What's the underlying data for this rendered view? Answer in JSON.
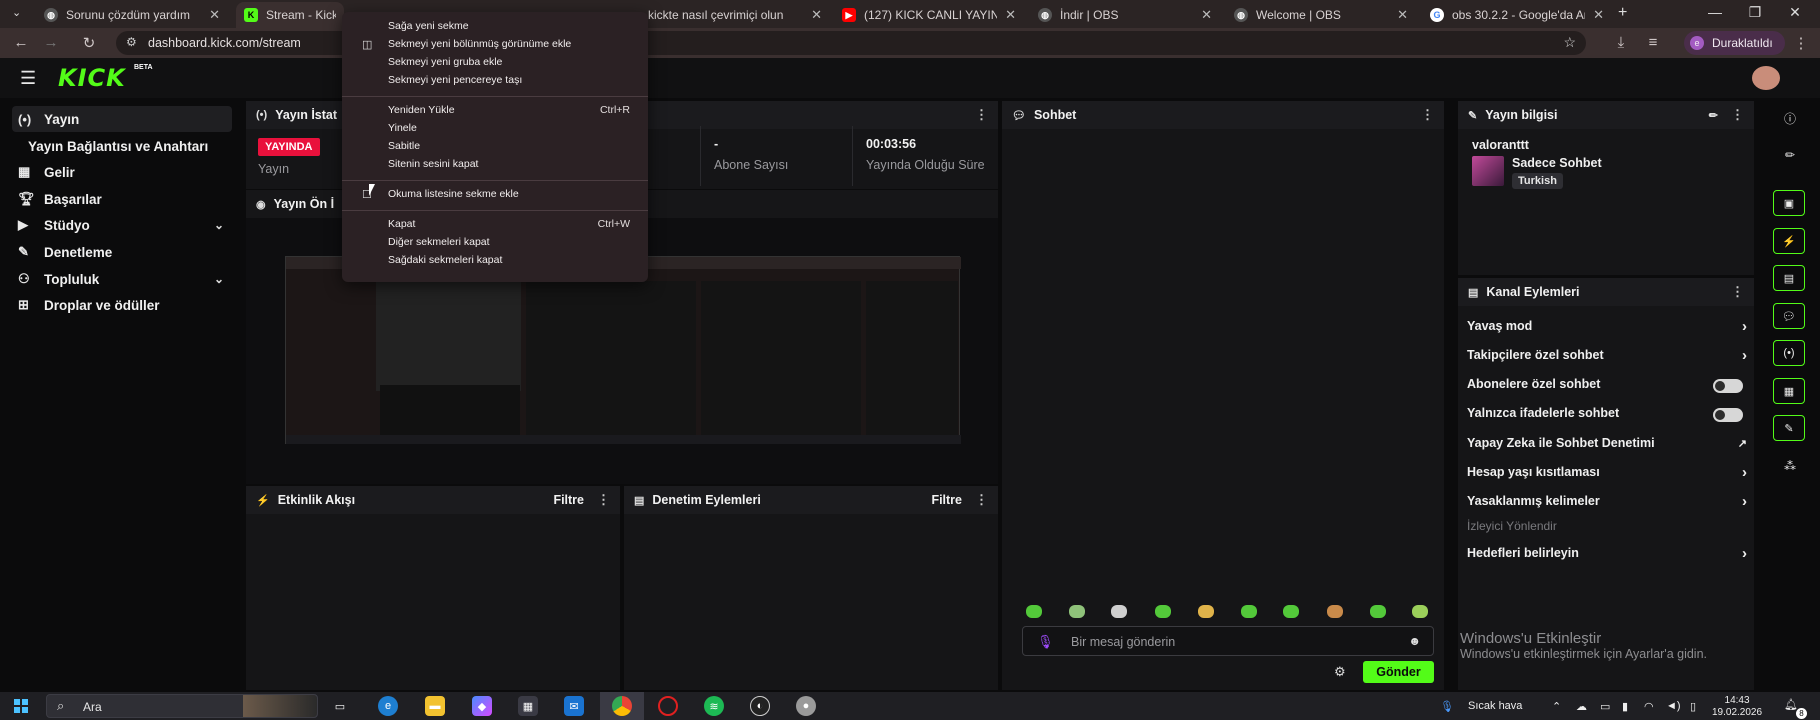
{
  "tabs": [
    {
      "title": "Sorunu çözdüm yardım",
      "icon": "globe-icon"
    },
    {
      "title": "Stream - Kick D",
      "icon": "kick-icon"
    },
    {
      "title": "kickte nasıl çevrimiçi olun",
      "icon": "globe-icon"
    },
    {
      "title": "(127) KICK CANLI YAYIN N",
      "icon": "youtube-icon"
    },
    {
      "title": "İndir | OBS",
      "icon": "globe-icon"
    },
    {
      "title": "Welcome | OBS",
      "icon": "globe-icon"
    },
    {
      "title": "obs 30.2.2 - Google'da Ar",
      "icon": "google-icon"
    }
  ],
  "address_bar": {
    "url": "dashboard.kick.com/stream",
    "profile_label": "Duraklatıldı",
    "profile_initial": "e"
  },
  "app": {
    "logo": "KICK",
    "beta": "BETA"
  },
  "sidebar": {
    "items": [
      {
        "label": "Yayın",
        "icon": "broadcast-icon",
        "active": true
      },
      {
        "label": "Yayın Bağlantısı ve Anahtarı",
        "icon": "",
        "active": false
      },
      {
        "label": "Gelir",
        "icon": "chart-icon",
        "active": false
      },
      {
        "label": "Başarılar",
        "icon": "trophy-icon",
        "active": false
      },
      {
        "label": "Stüdyo",
        "icon": "video-icon",
        "active": false,
        "expandable": true
      },
      {
        "label": "Denetleme",
        "icon": "wrench-icon",
        "active": false
      },
      {
        "label": "Topluluk",
        "icon": "community-icon",
        "active": false,
        "expandable": true
      },
      {
        "label": "Droplar ve ödüller",
        "icon": "gift-icon",
        "active": false
      }
    ]
  },
  "stats_panel": {
    "title": "Yayın İstat",
    "live_badge": "YAYINDA",
    "stats": [
      {
        "value": "",
        "label": "Yayın"
      },
      {
        "value": "-",
        "label": "Abone Sayısı"
      },
      {
        "value": "00:03:56",
        "label": "Yayında Olduğu Süre"
      }
    ]
  },
  "preview_panel": {
    "title": "Yayın Ön İ"
  },
  "activity_panel": {
    "title": "Etkinlik Akışı",
    "filter": "Filtre"
  },
  "moderation_panel": {
    "title": "Denetim Eylemleri",
    "filter": "Filtre"
  },
  "chat_panel": {
    "title": "Sohbet",
    "input_placeholder": "Bir mesaj gönderin",
    "send_label": "Gönder"
  },
  "stream_info": {
    "title": "Yayın bilgisi",
    "stream_title": "valoranttt",
    "category": "Sadece Sohbet",
    "language_tag": "Turkish"
  },
  "channel_actions": {
    "title": "Kanal Eylemleri",
    "items": [
      {
        "label": "Yavaş mod",
        "control": "arrow"
      },
      {
        "label": "Takipçilere özel sohbet",
        "control": "arrow"
      },
      {
        "label": "Abonelere özel sohbet",
        "control": "toggle",
        "enabled": false
      },
      {
        "label": "Yalnızca ifadelerle sohbet",
        "control": "toggle",
        "enabled": false
      },
      {
        "label": "Yapay Zeka ile Sohbet Denetimi",
        "control": "external"
      },
      {
        "label": "Hesap yaşı kısıtlaması",
        "control": "arrow"
      },
      {
        "label": "Yasaklanmış kelimeler",
        "control": "arrow"
      }
    ],
    "section_label": "İzleyici Yönlendir",
    "target_label": "Hedefleri belirleyin"
  },
  "windows_watermark": {
    "line1": "Windows'u Etkinleştir",
    "line2": "Windows'u etkinleştirmek için Ayarlar'a gidin."
  },
  "context_menu": {
    "items": [
      {
        "label": "Sağa yeni sekme",
        "shortcut": ""
      },
      {
        "label": "Sekmeyi yeni bölünmüş görünüme ekle",
        "shortcut": ""
      },
      {
        "label": "Sekmeyi yeni gruba ekle",
        "shortcut": ""
      },
      {
        "label": "Sekmeyi yeni pencereye taşı",
        "shortcut": ""
      },
      {
        "label": "Yeniden Yükle",
        "shortcut": "Ctrl+R"
      },
      {
        "label": "Yinele",
        "shortcut": ""
      },
      {
        "label": "Sabitle",
        "shortcut": ""
      },
      {
        "label": "Sitenin sesini kapat",
        "shortcut": ""
      },
      {
        "label": "Okuma listesine sekme ekle",
        "shortcut": ""
      },
      {
        "label": "Kapat",
        "shortcut": "Ctrl+W"
      },
      {
        "label": "Diğer sekmeleri kapat",
        "shortcut": ""
      },
      {
        "label": "Sağdaki sekmeleri kapat",
        "shortcut": ""
      }
    ]
  },
  "taskbar": {
    "search_label": "Ara",
    "weather": "Sıcak hava",
    "time": "14:43",
    "date": "19.02.2026",
    "notification_count": "8"
  },
  "colors": {
    "kick_green": "#53fc18",
    "live_red": "#e9113c",
    "panel_bg": "#151517"
  }
}
